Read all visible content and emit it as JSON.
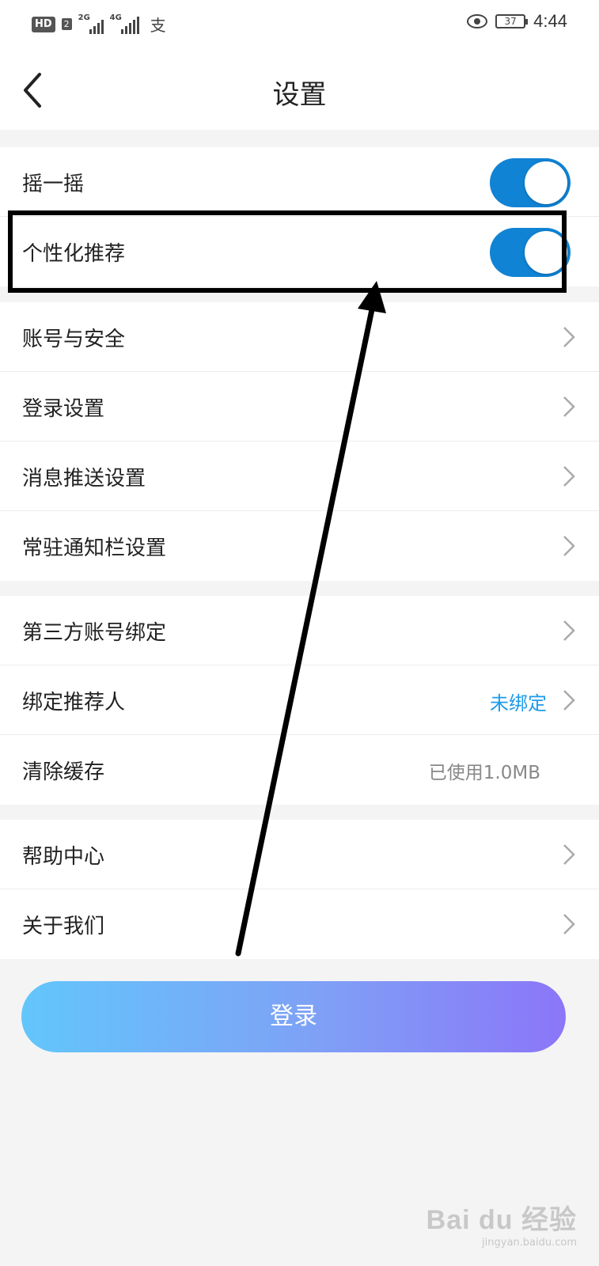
{
  "status_bar": {
    "hd_label": "HD",
    "hd_sub": "2",
    "net1": "2G",
    "net2": "4G",
    "pay_icon": "alipay-icon",
    "battery": "37",
    "time": "4:44"
  },
  "header": {
    "title": "设置"
  },
  "toggles": [
    {
      "label": "摇一摇",
      "on": true
    },
    {
      "label": "个性化推荐",
      "on": true
    }
  ],
  "group1": [
    {
      "label": "账号与安全"
    },
    {
      "label": "登录设置"
    },
    {
      "label": "消息推送设置"
    },
    {
      "label": "常驻通知栏设置"
    }
  ],
  "group2": [
    {
      "label": "第三方账号绑定"
    },
    {
      "label": "绑定推荐人",
      "value": "未绑定"
    },
    {
      "label": "清除缓存",
      "value": "已使用1.0MB"
    }
  ],
  "group3": [
    {
      "label": "帮助中心"
    },
    {
      "label": "关于我们"
    }
  ],
  "login_button": "登录",
  "watermark": {
    "main": "Bai du 经验",
    "sub": "jingyan.baidu.com"
  },
  "colors": {
    "accent": "#1083d4",
    "link": "#1e9be8",
    "gradient_start": "#62c6fb",
    "gradient_end": "#8b76f8"
  }
}
